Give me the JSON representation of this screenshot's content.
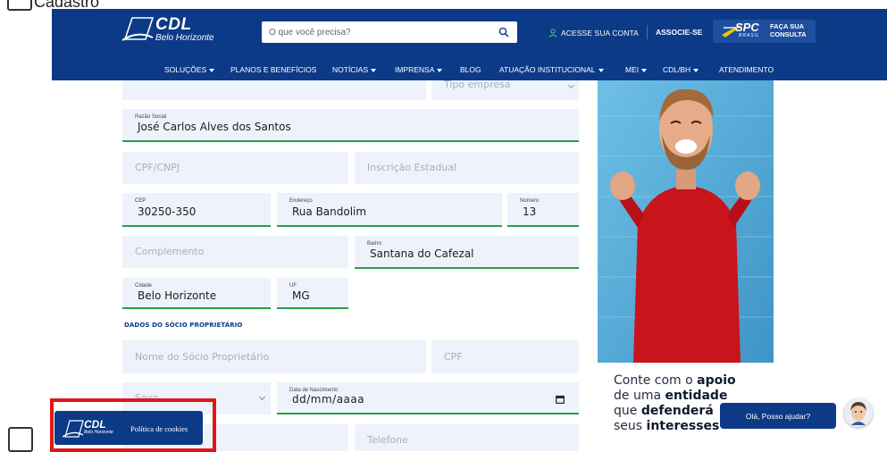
{
  "top_partial_text": "Cadastro",
  "header": {
    "logo": {
      "brand": "CDL",
      "city": "Belo Horizonte"
    },
    "search": {
      "placeholder": "O que você precisa?"
    },
    "account_label": "ACESSE SUA CONTA",
    "associate_label": "ASSOCIE-SE",
    "spc": {
      "brand": "SPC",
      "sub": "BRASIL",
      "cta_line1": "FAÇA SUA",
      "cta_line2": "CONSULTA"
    }
  },
  "nav": {
    "items": [
      {
        "label": "SOLUÇÕES",
        "dropdown": true
      },
      {
        "label": "PLANOS E BENEFÍCIOS",
        "dropdown": false
      },
      {
        "label": "NOTÍCIAS",
        "dropdown": true
      },
      {
        "label": "IMPRENSA",
        "dropdown": true
      },
      {
        "label": "BLOG",
        "dropdown": false
      },
      {
        "label": "ATUAÇÃO INSTITUCIONAL",
        "dropdown": true
      },
      {
        "label": "MEI",
        "dropdown": true
      },
      {
        "label": "CDL/BH",
        "dropdown": true
      },
      {
        "label": "ATENDIMENTO",
        "dropdown": false
      }
    ]
  },
  "form": {
    "tipo_empresa": {
      "placeholder": "Tipo empresa"
    },
    "razao_social": {
      "label": "Razão Social",
      "value": "José Carlos Alves dos Santos"
    },
    "cpf_cnpj": {
      "placeholder": "CPF/CNPJ"
    },
    "inscricao_estadual": {
      "placeholder": "Inscrição Estadual"
    },
    "cep": {
      "label": "CEP",
      "value": "30250-350"
    },
    "endereco": {
      "label": "Endereço",
      "value": "Rua Bandolim"
    },
    "numero": {
      "label": "Número",
      "value": "13"
    },
    "complemento": {
      "placeholder": "Complemento"
    },
    "bairro": {
      "label": "Bairro",
      "value": "Santana do Cafezal"
    },
    "cidade": {
      "label": "Cidade",
      "value": "Belo Horizonte"
    },
    "uf": {
      "label": "UF",
      "value": "MG"
    },
    "section_socio": "DADOS DO SÓCIO PROPRIETÁRIO",
    "nome_socio": {
      "placeholder": "Nome do Sócio Proprietário"
    },
    "cpf_socio": {
      "placeholder": "CPF"
    },
    "sexo": {
      "placeholder": "Sexo"
    },
    "data_nascimento": {
      "label": "Data de Nascimento",
      "value": "dd/mm/aaaa"
    },
    "telefone": {
      "placeholder": "Telefone"
    }
  },
  "promo": {
    "w1": "Conte com o ",
    "b1": "apoio",
    "w2": "de uma ",
    "b2": "entidade",
    "w3": "que ",
    "b3": "defenderá",
    "w4": "seus ",
    "b4": "interesses"
  },
  "cookie": {
    "brand": "CDL",
    "city": "Belo Horizonte",
    "label": "Política de cookies"
  },
  "chat": {
    "label": "Olá, Posso ajudar?"
  },
  "colors": {
    "header_blue": "#0c3a86",
    "valid_green": "#2a9c4a",
    "field_bg": "#eef3fb",
    "highlight_red": "#e01616"
  }
}
